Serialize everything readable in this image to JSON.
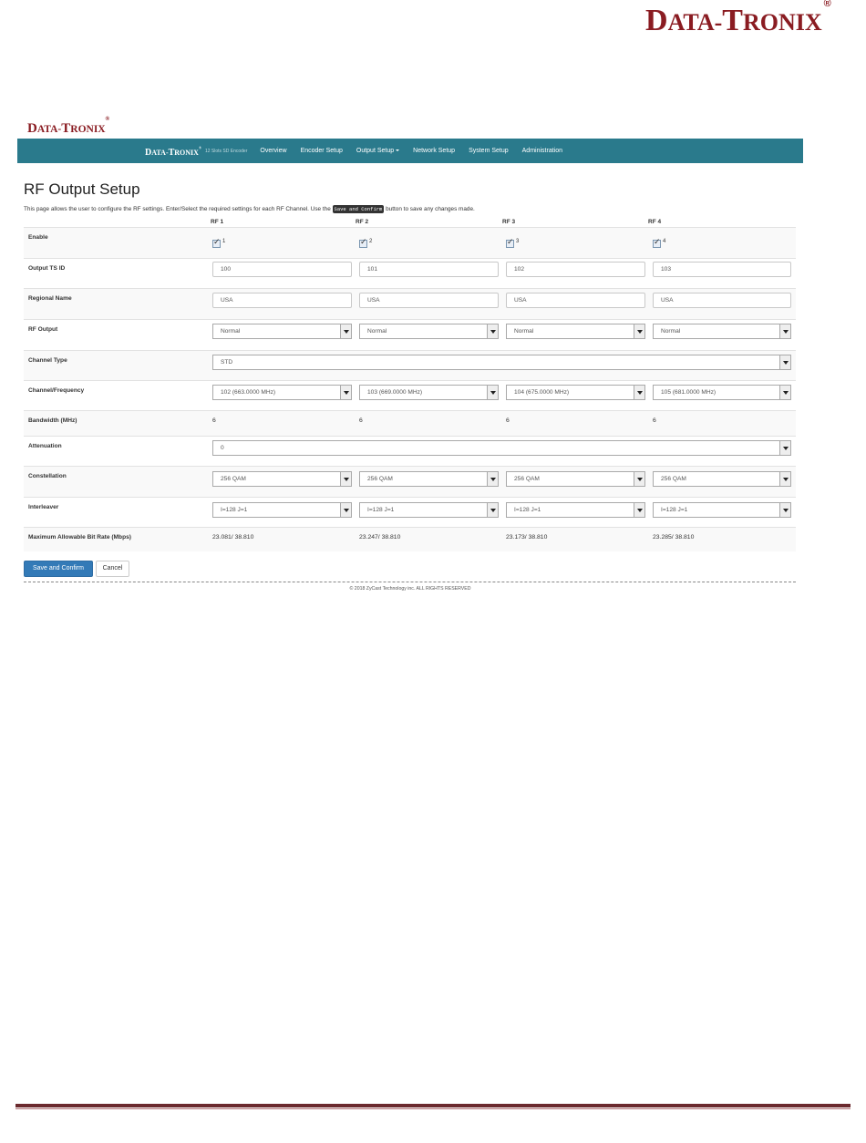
{
  "doc_logo": {
    "first": "D",
    "part1": "ATA-",
    "first2": "T",
    "part2": "RONIX",
    "reg": "®"
  },
  "app_logo": {
    "first": "D",
    "part1": "ATA-",
    "first2": "T",
    "part2": "RONIX",
    "reg": "®"
  },
  "nav": {
    "brand": {
      "first": "D",
      "part1": "ATA-",
      "first2": "T",
      "part2": "RONIX",
      "reg": "®"
    },
    "tagline": "12 Slots SD Encoder",
    "items": [
      "Overview",
      "Encoder Setup",
      "Output Setup",
      "Network Setup",
      "System Setup",
      "Administration"
    ]
  },
  "page": {
    "title": "RF Output Setup",
    "intro_before": "This page allows the user to configure the RF settings. Enter/Select the required settings for each RF Channel. Use the ",
    "intro_code": "Save and Confirm",
    "intro_after": " button to save any changes made."
  },
  "columns": [
    "RF 1",
    "RF 2",
    "RF 3",
    "RF 4"
  ],
  "labels": {
    "enable": "Enable",
    "output_ts_id": "Output TS ID",
    "regional_name": "Regional Name",
    "rf_output": "RF Output",
    "channel_type": "Channel Type",
    "channel_frequency": "Channel/Frequency",
    "bandwidth": "Bandwidth (MHz)",
    "attenuation": "Attenuation",
    "constellation": "Constellation",
    "interleaver": "Interleaver",
    "max_bitrate": "Maximum Allowable Bit Rate (Mbps)"
  },
  "enable_labels": [
    "1",
    "2",
    "3",
    "4"
  ],
  "enable_checked": [
    true,
    true,
    true,
    true
  ],
  "output_ts_id": [
    "100",
    "101",
    "102",
    "103"
  ],
  "regional_name": [
    "USA",
    "USA",
    "USA",
    "USA"
  ],
  "rf_output": [
    "Normal",
    "Normal",
    "Normal",
    "Normal"
  ],
  "channel_type": "STD",
  "channel_frequency": [
    "102 (663.0000 MHz)",
    "103 (669.0000 MHz)",
    "104 (675.0000 MHz)",
    "105 (681.0000 MHz)"
  ],
  "bandwidth": [
    "6",
    "6",
    "6",
    "6"
  ],
  "attenuation": "0",
  "constellation": [
    "256 QAM",
    "256 QAM",
    "256 QAM",
    "256 QAM"
  ],
  "interleaver": [
    "I=128 J=1",
    "I=128 J=1",
    "I=128 J=1",
    "I=128 J=1"
  ],
  "max_bitrate": [
    "23.081/ 38.810",
    "23.247/ 38.810",
    "23.173/ 38.810",
    "23.285/ 38.810"
  ],
  "buttons": {
    "save": "Save and Confirm",
    "cancel": "Cancel"
  },
  "copyright": "© 2018 ZyCast Technology inc. ALL RIGHTS RESERVED"
}
